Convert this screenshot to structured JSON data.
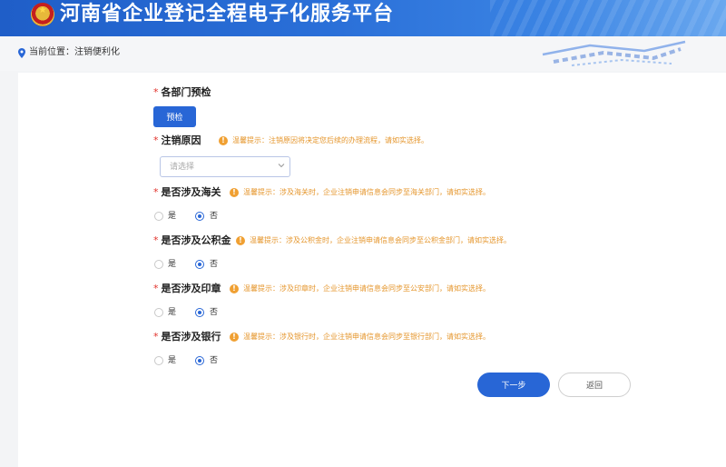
{
  "header": {
    "title": "河南省企业登记全程电子化服务平台"
  },
  "breadcrumb": {
    "prefix": "当前位置：",
    "current": "注销便利化"
  },
  "sections": {
    "precheck": {
      "label": "各部门预检",
      "button": "预检"
    },
    "reason": {
      "label": "注销原因",
      "tip": "温馨提示：注销原因将决定您后续的办理流程，请如实选择。",
      "placeholder": "请选择"
    },
    "customs": {
      "label": "是否涉及海关",
      "tip": "温馨提示：涉及海关时，企业注销申请信息会同步至海关部门，请如实选择。",
      "yes": "是",
      "no": "否",
      "selected": "否"
    },
    "fund": {
      "label": "是否涉及公积金",
      "tip": "温馨提示：涉及公积金时，企业注销申请信息会同步至公积金部门，请如实选择。",
      "yes": "是",
      "no": "否",
      "selected": "否"
    },
    "seal": {
      "label": "是否涉及印章",
      "tip": "温馨提示：涉及印章时，企业注销申请信息会同步至公安部门，请如实选择。",
      "yes": "是",
      "no": "否",
      "selected": "否"
    },
    "bank": {
      "label": "是否涉及银行",
      "tip": "温馨提示：涉及银行时，企业注销申请信息会同步至银行部门，请如实选择。",
      "yes": "是",
      "no": "否",
      "selected": "否"
    }
  },
  "actions": {
    "next": "下一步",
    "back": "返回"
  },
  "icons": {
    "breadcrumb": "location-pin-icon",
    "tip": "warning-icon",
    "select": "chevron-down-icon"
  },
  "colors": {
    "primary": "#2866d6",
    "required": "#e2322b",
    "warning": "#e5962c",
    "header": "#1f5ec8"
  }
}
